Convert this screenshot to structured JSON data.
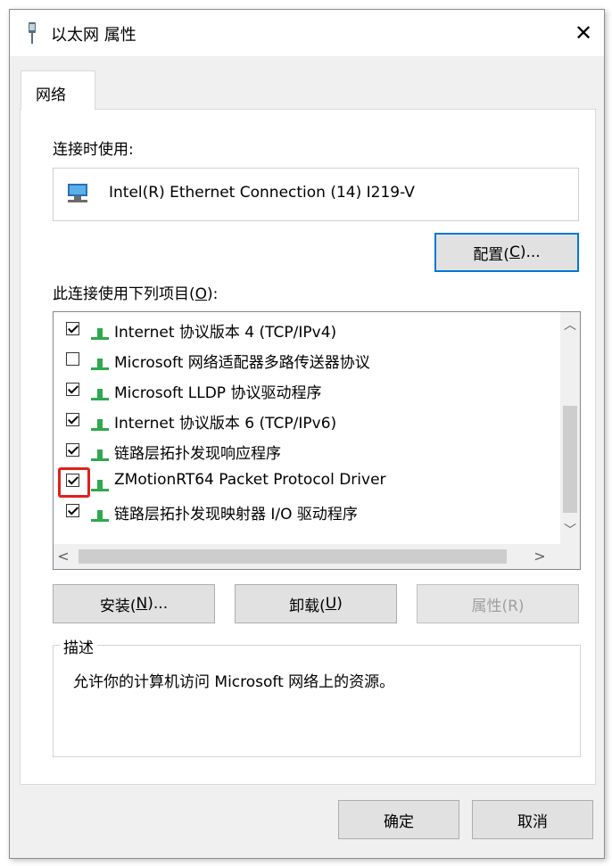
{
  "window": {
    "title": "以太网 属性",
    "close_glyph": "✕"
  },
  "tabs": [
    {
      "label": "网络",
      "active": true
    }
  ],
  "connect_using": {
    "label": "连接时使用:",
    "adapter": "Intel(R) Ethernet Connection (14) I219-V"
  },
  "configure_button": {
    "label_prefix": "配置(",
    "access_key": "C",
    "label_suffix": ")..."
  },
  "items_label": {
    "prefix": "此连接使用下列项目(",
    "access_key": "O",
    "suffix": "):"
  },
  "items": [
    {
      "label": "Internet 协议版本 4 (TCP/IPv4)",
      "checked": true
    },
    {
      "label": "Microsoft 网络适配器多路传送器协议",
      "checked": false
    },
    {
      "label": "Microsoft LLDP 协议驱动程序",
      "checked": true
    },
    {
      "label": "Internet 协议版本 6 (TCP/IPv6)",
      "checked": true
    },
    {
      "label": "链路层拓扑发现响应程序",
      "checked": true
    },
    {
      "label": "ZMotionRT64 Packet Protocol Driver",
      "checked": true,
      "highlighted": true
    },
    {
      "label": "链路层拓扑发现映射器 I/O 驱动程序",
      "checked": true
    }
  ],
  "scroll_glyphs": {
    "up": "︿",
    "down": "﹀",
    "left": "<",
    "right": ">"
  },
  "buttons": {
    "install": {
      "prefix": "安装(",
      "access_key": "N",
      "suffix": ")..."
    },
    "uninstall": {
      "prefix": "卸载(",
      "access_key": "U",
      "suffix": ")"
    },
    "properties": {
      "label": "属性(R)"
    }
  },
  "description": {
    "legend": "描述",
    "text": "允许你的计算机访问 Microsoft 网络上的资源。"
  },
  "footer": {
    "ok": "确定",
    "cancel": "取消"
  },
  "colors": {
    "highlight": "#e0201b",
    "accent": "#0078d7",
    "icon_green": "#2fa84f"
  }
}
